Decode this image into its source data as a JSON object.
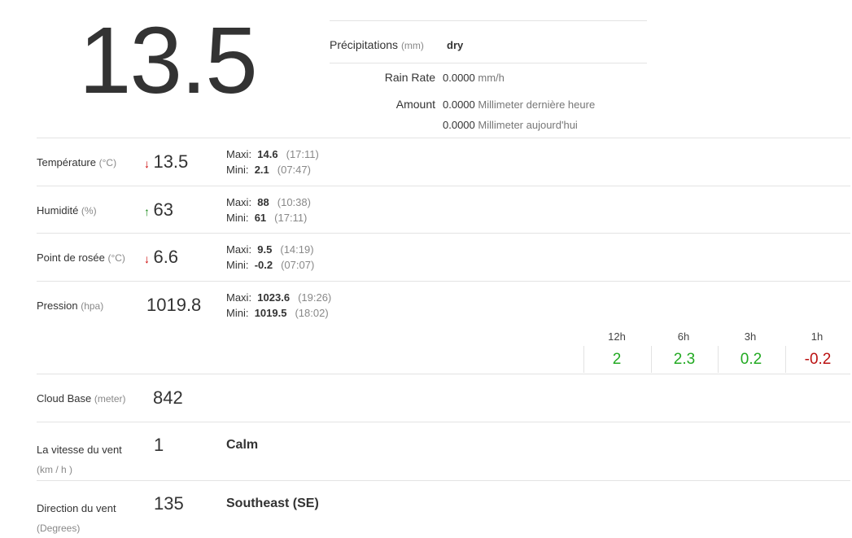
{
  "current": {
    "temperature": "13.5"
  },
  "precipitation": {
    "label": "Précipitations",
    "unit": "(mm)",
    "status": "dry",
    "rain_rate_label": "Rain Rate",
    "rain_rate_value": "0.0000",
    "rain_rate_unit": "mm/h",
    "amount_label": "Amount",
    "amount_hour_value": "0.0000",
    "amount_hour_unit": "Millimeter dernière heure",
    "amount_day_value": "0.0000",
    "amount_day_unit": "Millimeter aujourd'hui"
  },
  "rows": {
    "temperature": {
      "label": "Température",
      "unit": "(°C)",
      "trend_arrow": "↓",
      "value": "13.5",
      "max_label": "Maxi:",
      "max_value": "14.6",
      "max_time": "(17:11)",
      "min_label": "Mini:",
      "min_value": "2.1",
      "min_time": "(07:47)"
    },
    "humidity": {
      "label": "Humidité",
      "unit": "(%)",
      "trend_arrow": "↑",
      "value": "63",
      "max_label": "Maxi:",
      "max_value": "88",
      "max_time": "(10:38)",
      "min_label": "Mini:",
      "min_value": "61",
      "min_time": "(17:11)"
    },
    "dewpoint": {
      "label": "Point de rosée",
      "unit": "(°C)",
      "trend_arrow": "↓",
      "value": "6.6",
      "max_label": "Maxi:",
      "max_value": "9.5",
      "max_time": "(14:19)",
      "min_label": "Mini:",
      "min_value": "-0.2",
      "min_time": "(07:07)"
    },
    "pressure": {
      "label": "Pression",
      "unit": "(hpa)",
      "value": "1019.8",
      "max_label": "Maxi:",
      "max_value": "1023.6",
      "max_time": "(19:26)",
      "min_label": "Mini:",
      "min_value": "1019.5",
      "min_time": "(18:02)"
    },
    "cloudbase": {
      "label": "Cloud Base",
      "unit": "(meter)",
      "value": "842"
    },
    "windspeed": {
      "label": "La vitesse du vent",
      "unit": "(km / h )",
      "value": "1",
      "description": "Calm"
    },
    "winddir": {
      "label": "Direction du vent",
      "unit": "(Degrees)",
      "value": "135",
      "description": "Southeast (SE)"
    }
  },
  "pressure_trend": [
    {
      "period": "12h",
      "value": "2",
      "color": "#22aa22"
    },
    {
      "period": "6h",
      "value": "2.3",
      "color": "#22aa22"
    },
    {
      "period": "3h",
      "value": "0.2",
      "color": "#22aa22"
    },
    {
      "period": "1h",
      "value": "-0.2",
      "color": "#bb1111"
    }
  ],
  "colors": {
    "trend_down": "#cc0000",
    "trend_up": "#1a8a1a",
    "divider": "#e3e3e3"
  }
}
